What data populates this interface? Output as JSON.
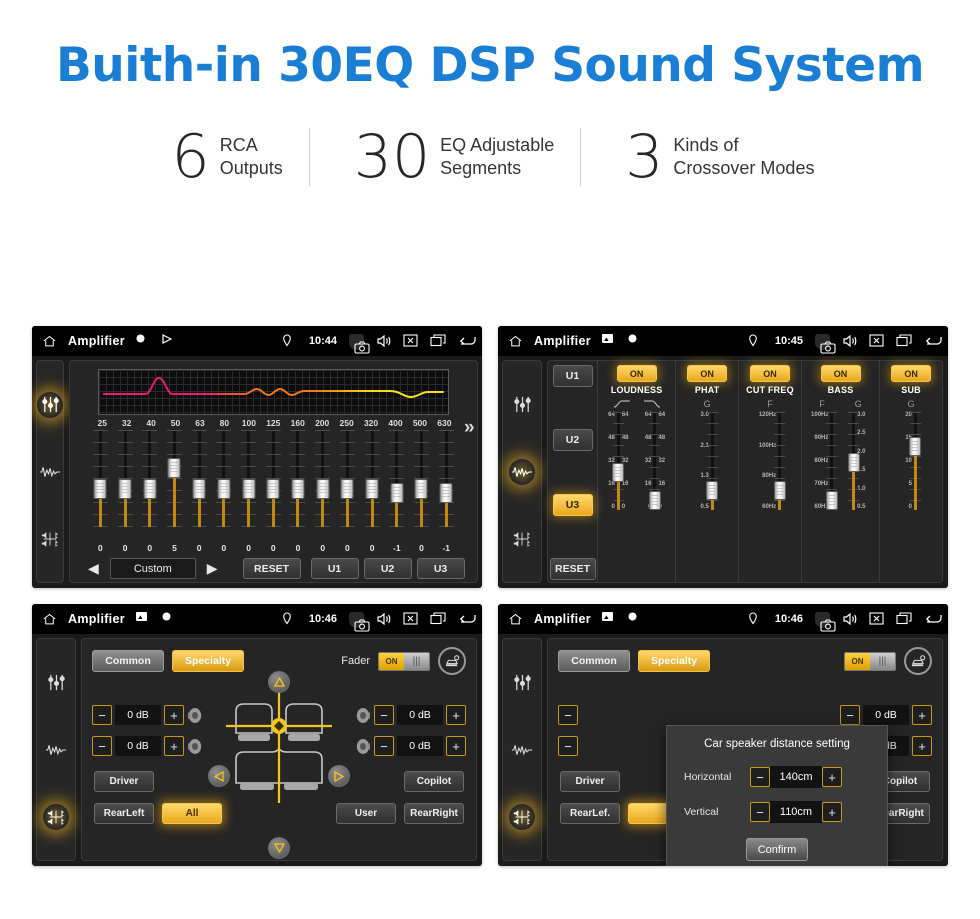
{
  "header": {
    "title": "Buith-in 30EQ DSP Sound System",
    "stats": [
      {
        "num": "6",
        "text": "RCA\nOutputs"
      },
      {
        "num": "30",
        "text": "EQ Adjustable\nSegments"
      },
      {
        "num": "3",
        "text": "Kinds of\nCrossover Modes"
      }
    ]
  },
  "colors": {
    "title_blue": "#1a7fd4",
    "accent_amber": "#e9a81a",
    "screen_bg": "#1b1b1b"
  },
  "panel1": {
    "statusbar": {
      "app_title": "Amplifier",
      "time": "10:44"
    },
    "sidebar": [
      {
        "icon": "eq-sliders-icon",
        "active": true
      },
      {
        "icon": "waveform-icon",
        "active": false
      },
      {
        "icon": "balance-fader-icon",
        "active": false
      }
    ],
    "eq": {
      "frequencies": [
        "25",
        "32",
        "40",
        "50",
        "63",
        "80",
        "100",
        "125",
        "160",
        "200",
        "250",
        "320",
        "400",
        "500",
        "630"
      ],
      "values": [
        "0",
        "0",
        "0",
        "5",
        "0",
        "0",
        "0",
        "0",
        "0",
        "0",
        "0",
        "0",
        "-1",
        "0",
        "-1"
      ],
      "curve_colors": [
        "#e8196e",
        "#f07a18",
        "#f5e11a"
      ]
    },
    "controls": {
      "prev_label": "◀",
      "preset_label": "Custom",
      "next_label": "▶",
      "reset_label": "RESET",
      "user_presets": [
        "U1",
        "U2",
        "U3"
      ],
      "more_label": "»"
    }
  },
  "panel2": {
    "statusbar": {
      "app_title": "Amplifier",
      "time": "10:45"
    },
    "sidebar": [
      {
        "icon": "eq-sliders-icon",
        "active": false
      },
      {
        "icon": "waveform-icon",
        "active": true
      },
      {
        "icon": "balance-fader-icon",
        "active": false
      }
    ],
    "user_column": {
      "presets": [
        {
          "label": "U1",
          "selected": false
        },
        {
          "label": "U2",
          "selected": false
        },
        {
          "label": "U3",
          "selected": true
        }
      ],
      "reset_label": "RESET"
    },
    "effects": [
      {
        "name": "LOUDNESS",
        "state": "ON",
        "symbol": "curves",
        "sliders": [
          {
            "label": "",
            "ticks": [
              "64",
              "48",
              "32",
              "16",
              "0"
            ],
            "pos": 0.52
          },
          {
            "label": "",
            "ticks": [
              "64",
              "48",
              "32",
              "16",
              "0"
            ],
            "pos": 0.93
          }
        ]
      },
      {
        "name": "PHAT",
        "state": "ON",
        "symbol": "G",
        "sliders": [
          {
            "label": "G",
            "ticks": [
              "3.0",
              "2.1",
              "1.3",
              "0.5"
            ],
            "pos": 0.7
          }
        ]
      },
      {
        "name": "CUT FREQ",
        "state": "ON",
        "symbol": "F",
        "sliders": [
          {
            "label": "F",
            "ticks": [
              "120Hz",
              "100Hz",
              "80Hz",
              "60Hz"
            ],
            "pos": 0.7
          }
        ]
      },
      {
        "name": "BASS",
        "state": "ON",
        "symbol": "F G",
        "sliders": [
          {
            "label": "F",
            "ticks": [
              "100Hz",
              "90Hz",
              "80Hz",
              "70Hz",
              "60Hz"
            ],
            "pos": 0.95
          },
          {
            "label": "G",
            "ticks": [
              "3.0",
              "2.5",
              "2.0",
              "1.5",
              "1.0",
              "0.5"
            ],
            "pos": 0.42
          }
        ]
      },
      {
        "name": "SUB",
        "state": "ON",
        "symbol": "G",
        "sliders": [
          {
            "label": "G",
            "ticks": [
              "20",
              "15",
              "10",
              "5",
              "0"
            ],
            "pos": 0.25
          }
        ]
      }
    ]
  },
  "panel3": {
    "statusbar": {
      "app_title": "Amplifier",
      "time": "10:46"
    },
    "sidebar": [
      {
        "icon": "eq-sliders-icon",
        "active": false
      },
      {
        "icon": "waveform-icon",
        "active": false
      },
      {
        "icon": "balance-fader-icon",
        "active": true
      }
    ],
    "tabs": [
      {
        "label": "Common",
        "active": false
      },
      {
        "label": "Specialty",
        "active": true
      }
    ],
    "fader": {
      "label": "Fader",
      "state": "ON"
    },
    "car_settings_icon": "car-settings-icon",
    "gain_controls": [
      {
        "position": "front-left",
        "value": "0 dB",
        "minus": "−",
        "plus": "+"
      },
      {
        "position": "rear-left",
        "value": "0 dB",
        "minus": "−",
        "plus": "+"
      },
      {
        "position": "front-right",
        "value": "0 dB",
        "minus": "−",
        "plus": "+"
      },
      {
        "position": "rear-right",
        "value": "0 dB",
        "minus": "−",
        "plus": "+"
      }
    ],
    "seat_buttons": [
      {
        "label": "Driver",
        "selected": false
      },
      {
        "label": "Copilot",
        "selected": false
      },
      {
        "label": "RearLeft",
        "selected": false
      },
      {
        "label": "All",
        "selected": true
      },
      {
        "label": "User",
        "selected": false
      },
      {
        "label": "RearRight",
        "selected": false
      }
    ],
    "nudge": {
      "up": "△",
      "down": "▽",
      "left": "◁",
      "right": "▷"
    }
  },
  "panel4": {
    "statusbar": {
      "app_title": "Amplifier",
      "time": "10:46"
    },
    "sidebar": [
      {
        "icon": "eq-sliders-icon",
        "active": false
      },
      {
        "icon": "waveform-icon",
        "active": false
      },
      {
        "icon": "balance-fader-icon",
        "active": true
      }
    ],
    "tabs": [
      {
        "label": "Common",
        "active": false
      },
      {
        "label": "Specialty",
        "active": true
      }
    ],
    "fader": {
      "label": "Fader",
      "state": "ON"
    },
    "seat_buttons": [
      {
        "label": "Driver",
        "selected": false
      },
      {
        "label": "Copilot",
        "selected": false
      },
      {
        "label": "RearLef.",
        "selected": false
      },
      {
        "label": "RearRight",
        "selected": false
      }
    ],
    "gain_controls": [
      {
        "position": "front-right",
        "value": "0 dB"
      },
      {
        "position": "rear-right",
        "value": "0 dB"
      }
    ],
    "dialog": {
      "title": "Car speaker distance setting",
      "rows": [
        {
          "label": "Horizontal",
          "value": "140cm",
          "minus": "−",
          "plus": "+"
        },
        {
          "label": "Vertical",
          "value": "110cm",
          "minus": "−",
          "plus": "+"
        }
      ],
      "confirm_label": "Confirm"
    }
  }
}
